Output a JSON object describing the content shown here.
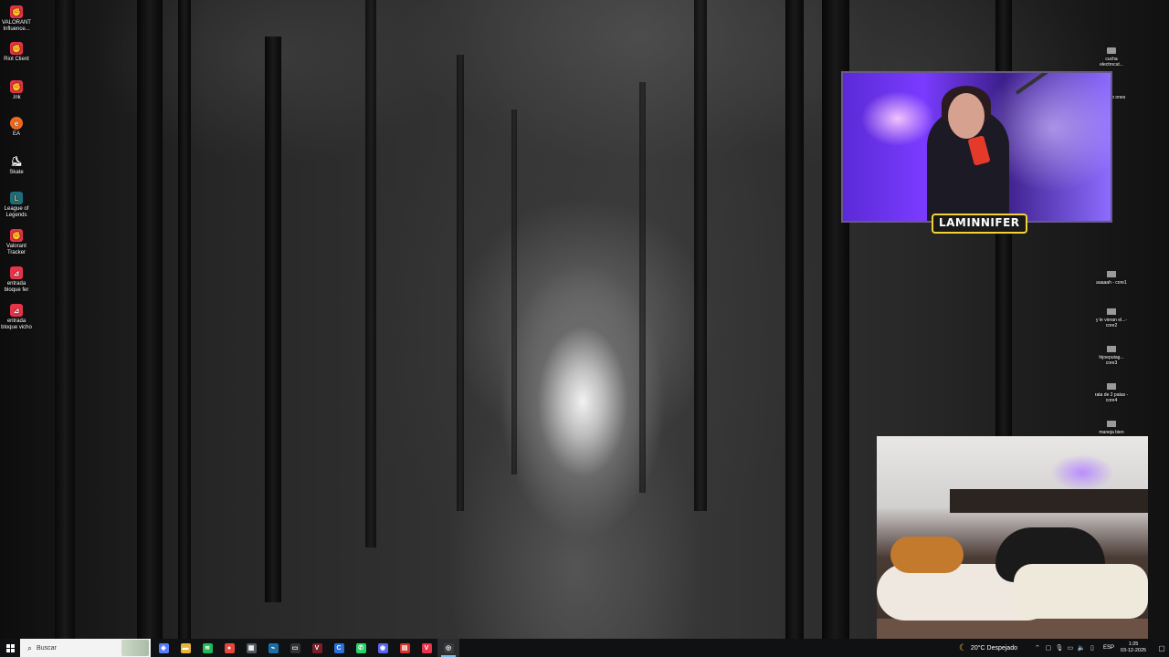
{
  "desktop": {
    "left_icons": [
      {
        "label": "VALORANT Influence...",
        "icon": "riot-icon"
      },
      {
        "label": "Riot Client",
        "icon": "riot-icon"
      },
      {
        "label": ".lnk",
        "icon": "riot-icon"
      },
      {
        "label": "EA",
        "icon": "ea-icon"
      },
      {
        "label": "Skate",
        "icon": "skate-icon"
      },
      {
        "label": "League of Legends",
        "icon": "lol-icon"
      },
      {
        "label": "Valorant Tracker",
        "icon": "riot-icon"
      },
      {
        "label": "entrada bloque fer",
        "icon": "pdf-icon"
      },
      {
        "label": "entrada bloque vicho",
        "icon": "pdf-icon"
      }
    ],
    "right_icons": [
      {
        "label": "cucha electrocut..."
      },
      {
        "label": "ano ones"
      },
      {
        "label": "aaaaah - core1"
      },
      {
        "label": "y le vieran el...-core2"
      },
      {
        "label": "hijoeputag... core3"
      },
      {
        "label": "rata de 2 patas -core4"
      },
      {
        "label": "maneja bien"
      }
    ]
  },
  "stream": {
    "nameplate": "LAMINNIFER"
  },
  "taskbar": {
    "search_placeholder": "Buscar",
    "apps": [
      {
        "name": "copilot-icon",
        "glyph": "◆",
        "color": "#5a7cff"
      },
      {
        "name": "file-explorer-icon",
        "glyph": "▬",
        "color": "#e8b43a"
      },
      {
        "name": "spotify-icon",
        "glyph": "≋",
        "color": "#1db954"
      },
      {
        "name": "chrome-icon",
        "glyph": "●",
        "color": "#e8453c"
      },
      {
        "name": "calculator-icon",
        "glyph": "▦",
        "color": "#555a63"
      },
      {
        "name": "steam-icon",
        "glyph": "⌁",
        "color": "#1b6fa8"
      },
      {
        "name": "stream-deck-icon",
        "glyph": "▭",
        "color": "#333"
      },
      {
        "name": "vanguard-icon",
        "glyph": "V",
        "color": "#7a1f2a"
      },
      {
        "name": "refresh-app-icon",
        "glyph": "C",
        "color": "#2a6fdb"
      },
      {
        "name": "whatsapp-icon",
        "glyph": "✆",
        "color": "#25d366"
      },
      {
        "name": "discord-icon",
        "glyph": "◉",
        "color": "#5865f2"
      },
      {
        "name": "obs-red-icon",
        "glyph": "▤",
        "color": "#d6342c"
      },
      {
        "name": "valorant-app-icon",
        "glyph": "V",
        "color": "#e8334a"
      },
      {
        "name": "obs-icon",
        "glyph": "◎",
        "color": "#3a3a3a"
      }
    ],
    "weather": "20°C Despejado",
    "language": "ESP",
    "time": "1:25",
    "date": "03-12-2025"
  }
}
